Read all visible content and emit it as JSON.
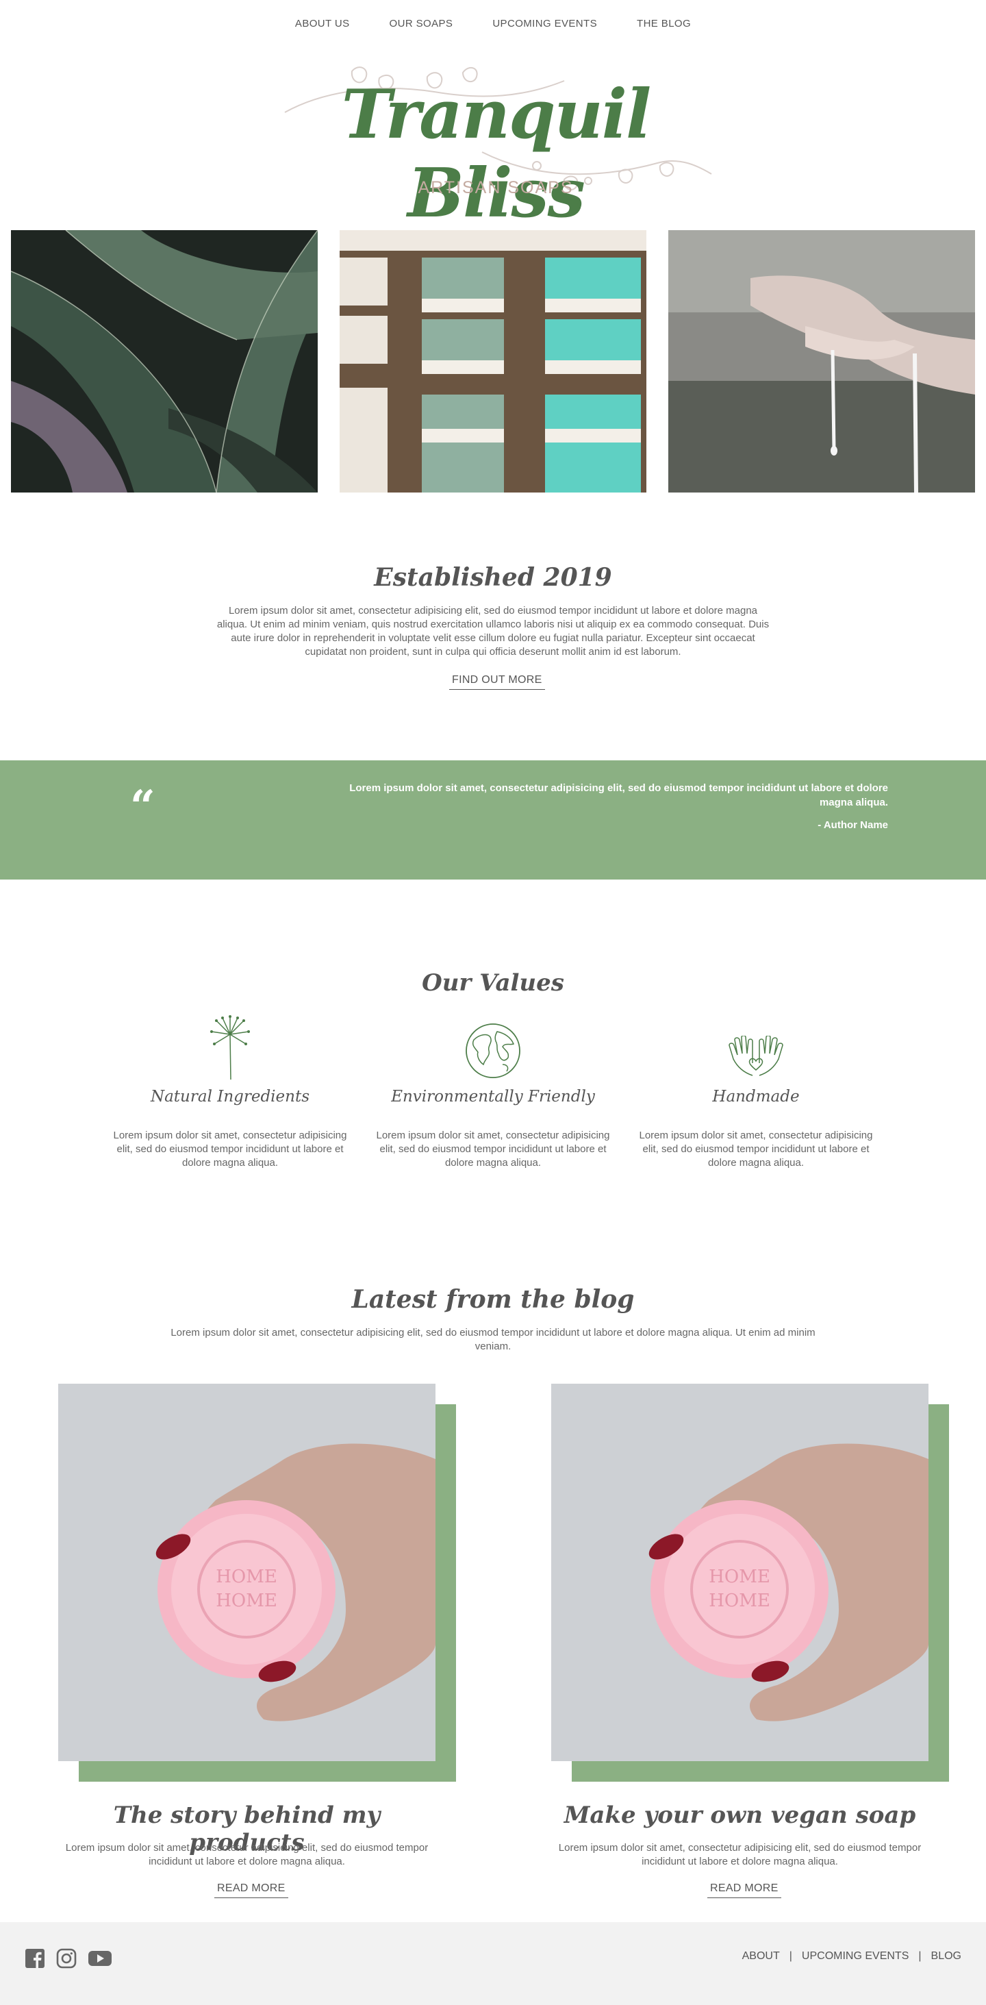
{
  "nav": [
    "ABOUT US",
    "OUR SOAPS",
    "UPCOMING EVENTS",
    "THE BLOG"
  ],
  "logo": {
    "title": "Tranquil Bliss",
    "subtitle": "ARTISAN SOAPS"
  },
  "colors": {
    "brand_green": "#4c7d48",
    "band_green": "#8bb083",
    "footer_bg": "#f2f2f2"
  },
  "hero_photos": [
    {
      "name": "agave-leaves-photo"
    },
    {
      "name": "soap-bars-photo"
    },
    {
      "name": "hands-water-photo"
    }
  ],
  "established": {
    "title": "Established 2019",
    "text": "Lorem ipsum dolor sit amet, consectetur adipisicing elit, sed do eiusmod tempor incididunt ut labore et dolore magna aliqua. Ut enim ad minim veniam, quis nostrud exercitation ullamco laboris nisi ut aliquip ex ea commodo consequat. Duis aute irure dolor in reprehenderit in voluptate velit esse cillum dolore eu fugiat nulla pariatur. Excepteur sint occaecat cupidatat non proident, sunt in culpa qui officia deserunt mollit anim id est laborum.",
    "button": "FIND OUT MORE"
  },
  "quote": {
    "mark": "“",
    "text": "Lorem ipsum dolor sit amet, consectetur adipisicing elit, sed do eiusmod tempor incididunt ut labore et dolore magna aliqua.",
    "author": "- Author Name"
  },
  "values": {
    "title": "Our Values",
    "items": [
      {
        "icon": "dandelion-icon",
        "title": "Natural Ingredients",
        "text": "Lorem ipsum dolor sit amet, consectetur adipisicing elit, sed do eiusmod tempor incididunt ut labore et dolore magna aliqua."
      },
      {
        "icon": "globe-icon",
        "title": "Environmentally Friendly",
        "text": "Lorem ipsum dolor sit amet, consectetur adipisicing elit, sed do eiusmod tempor incididunt ut labore et dolore magna aliqua."
      },
      {
        "icon": "hands-heart-icon",
        "title": "Handmade",
        "text": "Lorem ipsum dolor sit amet, consectetur adipisicing elit, sed do eiusmod tempor incididunt ut labore et dolore magna aliqua."
      }
    ]
  },
  "blog": {
    "title": "Latest from the blog",
    "intro": "Lorem ipsum dolor sit amet, consectetur adipisicing elit, sed do eiusmod tempor incididunt ut labore et dolore magna aliqua. Ut enim ad minim veniam.",
    "posts": [
      {
        "title": "The story behind my products",
        "text": "Lorem ipsum dolor sit amet, consectetur adipisicing elit, sed do eiusmod tempor incididunt ut labore et dolore magna aliqua.",
        "button": "READ MORE",
        "image_stamp": "HOME HOME"
      },
      {
        "title": "Make your own vegan soap",
        "text": "Lorem ipsum dolor sit amet, consectetur adipisicing elit, sed do eiusmod tempor incididunt ut labore et dolore magna aliqua.",
        "button": "READ MORE",
        "image_stamp": "HOME HOME"
      }
    ]
  },
  "footer": {
    "social": [
      "facebook-icon",
      "instagram-icon",
      "youtube-icon"
    ],
    "links": [
      "ABOUT",
      "UPCOMING EVENTS",
      "BLOG"
    ],
    "separator": "|"
  }
}
